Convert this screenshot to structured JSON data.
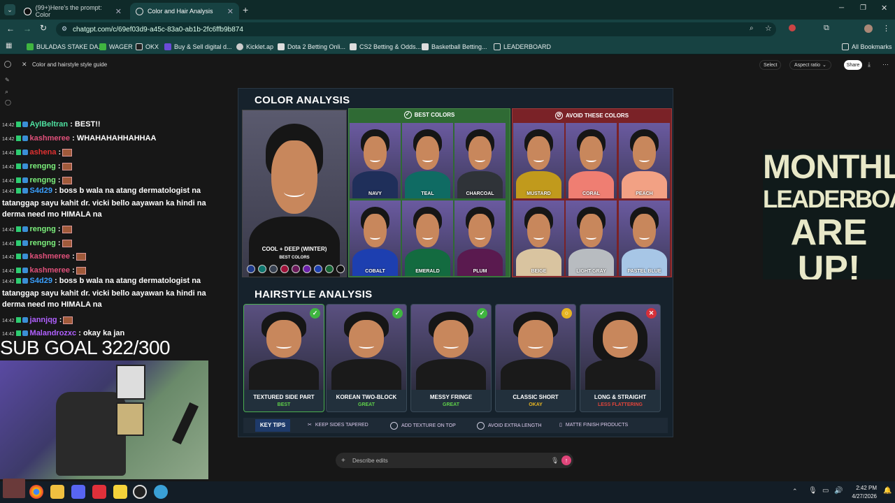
{
  "browser": {
    "tabs": [
      {
        "label": "(99+)Here's the prompt: Color",
        "active": false
      },
      {
        "label": "Color and Hair Analysis",
        "active": true
      }
    ],
    "new_tab": "+",
    "url": "chatgpt.com/c/69ef03d9-a45c-83a0-ab1b-2fc6ffb9b874",
    "bookmarks": [
      "BULADAS STAKE DA...",
      "WAGER",
      "OKX",
      "Buy & Sell digital d...",
      "Kicklet.ap",
      "Dota 2 Betting Onli...",
      "CS2 Betting & Odds...",
      "Basketball Betting...",
      "LEADERBOARD"
    ],
    "all_bookmarks": "All Bookmarks"
  },
  "chatgpt": {
    "doc_title": "Color and hairstyle style guide",
    "select": "Select",
    "aspect": "Aspect ratio",
    "share": "Share",
    "prompt_placeholder": "Describe edits"
  },
  "chat": [
    {
      "time": "14:42",
      "user": "AylBeltran",
      "color": "#4ee0a0",
      "msg": ": BEST!!"
    },
    {
      "time": "14:42",
      "user": "kashmeree",
      "color": "#e0507a",
      "msg": ": WHAHAHAHHAHHAA"
    },
    {
      "time": "14:42",
      "user": "ashena",
      "color": "#e03030",
      "msg": ":"
    },
    {
      "time": "14:42",
      "user": "rengng",
      "color": "#7cf07c",
      "msg": ":"
    },
    {
      "time": "14:42",
      "user": "rengng",
      "color": "#7cf07c",
      "msg": ":"
    },
    {
      "time": "14:42",
      "user": "S4d29",
      "color": "#3aa0ff",
      "msg": ": boss b wala na atang dermatologist na tatanggap sayu kahit dr. vicki bello aayawan ka hindi na derma need mo HIMALA na"
    },
    {
      "time": "14:42",
      "user": "rengng",
      "color": "#7cf07c",
      "msg": ":"
    },
    {
      "time": "14:42",
      "user": "rengng",
      "color": "#7cf07c",
      "msg": ":"
    },
    {
      "time": "14:42",
      "user": "kashmeree",
      "color": "#e0507a",
      "msg": ":"
    },
    {
      "time": "14:42",
      "user": "kashmeree",
      "color": "#e0507a",
      "msg": ":"
    },
    {
      "time": "14:42",
      "user": "S4d29",
      "color": "#3aa0ff",
      "msg": ": boss b wala na atang dermatologist na tatanggap sayu kahit dr. vicki bello aayawan ka hindi na derma need mo HIMALA na"
    },
    {
      "time": "14:42",
      "user": "jannjqg",
      "color": "#b060ff",
      "msg": ":"
    },
    {
      "time": "14:42",
      "user": "Malandrozxc",
      "color": "#b060ff",
      "msg": ": okay ka jan"
    }
  ],
  "sub_goal": "SUB GOAL 322/300",
  "leaderboard_banner": [
    "MONTHLY",
    "LEADERBOARDS",
    "ARE UP!"
  ],
  "color_analysis": {
    "title": "COLOR ANALYSIS",
    "main_label": "COOL + DEEP (WINTER)",
    "best_colors_label": "BEST COLORS",
    "swatches": [
      "#1e3a8a",
      "#0f766e",
      "#374151",
      "#9f1239",
      "#6b1a5a",
      "#6b21a8",
      "#1e40af",
      "#166534",
      "#111111"
    ],
    "best_header": "BEST COLORS",
    "avoid_header": "AVOID THESE COLORS",
    "best": [
      {
        "name": "NAVY",
        "color": "#1f2f5a"
      },
      {
        "name": "TEAL",
        "color": "#0f6b63"
      },
      {
        "name": "CHARCOAL",
        "color": "#2f3338"
      },
      {
        "name": "COBALT",
        "color": "#1d3fb0"
      },
      {
        "name": "EMERALD",
        "color": "#136b40"
      },
      {
        "name": "PLUM",
        "color": "#5a1a4f"
      }
    ],
    "avoid": [
      {
        "name": "MUSTARD",
        "color": "#c19a1c"
      },
      {
        "name": "CORAL",
        "color": "#ef7e72"
      },
      {
        "name": "PEACH",
        "color": "#f2a184"
      },
      {
        "name": "BEIGE",
        "color": "#d9c4a0"
      },
      {
        "name": "LIGHT GRAY",
        "color": "#b8bcc0"
      },
      {
        "name": "PASTEL BLUE",
        "color": "#a7c6e6"
      }
    ]
  },
  "hairstyle_analysis": {
    "title": "HAIRSTYLE ANALYSIS",
    "styles": [
      {
        "name": "TEXTURED SIDE PART",
        "rating": "BEST",
        "rating_color": "#5fd04a",
        "badge": "✓",
        "badge_color": "#3fb540"
      },
      {
        "name": "KOREAN TWO-BLOCK",
        "rating": "GREAT",
        "rating_color": "#5fd04a",
        "badge": "✓",
        "badge_color": "#3fb540"
      },
      {
        "name": "MESSY FRINGE",
        "rating": "GREAT",
        "rating_color": "#5fd04a",
        "badge": "✓",
        "badge_color": "#3fb540"
      },
      {
        "name": "CLASSIC SHORT",
        "rating": "OKAY",
        "rating_color": "#e6b422",
        "badge": "○",
        "badge_color": "#e6b422"
      },
      {
        "name": "LONG & STRAIGHT",
        "rating": "LESS FLATTERING",
        "rating_color": "#e0443a",
        "badge": "✕",
        "badge_color": "#d6303a"
      }
    ],
    "tips_title": "KEY TIPS",
    "tips": [
      "KEEP SIDES TAPERED",
      "ADD TEXTURE ON TOP",
      "AVOID EXTRA LENGTH",
      "MATTE FINISH PRODUCTS"
    ]
  },
  "taskbar": {
    "time": "2:42 PM",
    "date": "4/27/2026"
  }
}
